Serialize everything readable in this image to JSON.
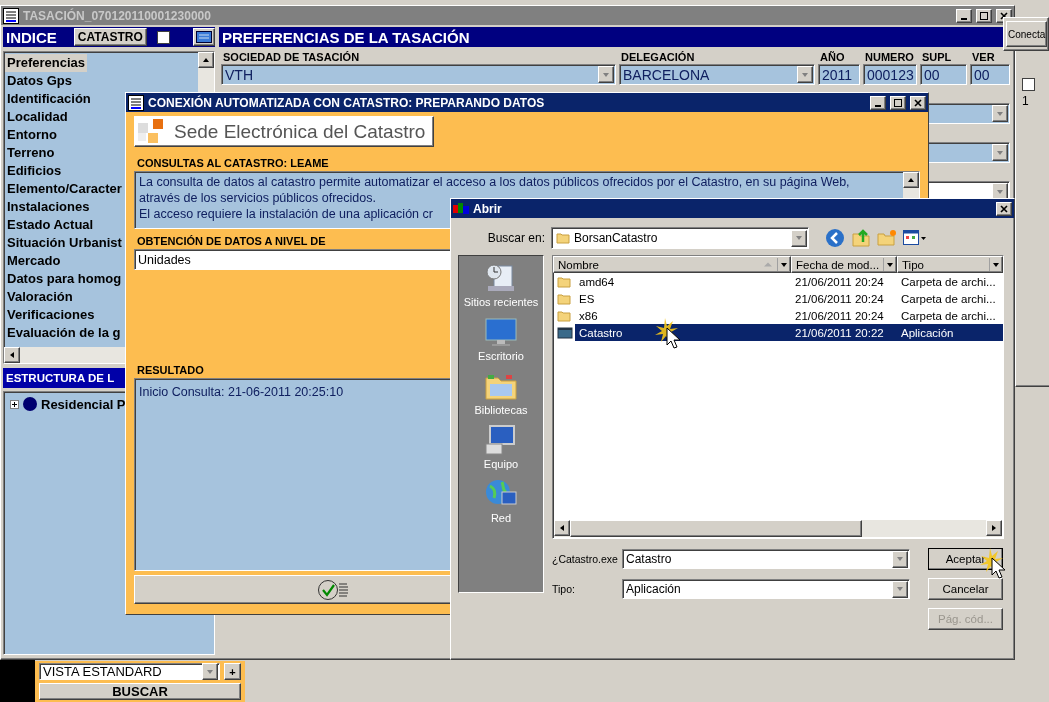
{
  "main_window": {
    "title": "TASACIÓN_070120110001230000"
  },
  "index_panel": {
    "title": "INDICE",
    "catastro_button": "CATASTRO",
    "checked": false,
    "items": [
      {
        "label": "Preferencias",
        "selected": true
      },
      {
        "label": "Datos Gps",
        "selected": false
      },
      {
        "label": "Identificación",
        "selected": false
      },
      {
        "label": "Localidad",
        "selected": false
      },
      {
        "label": "Entorno",
        "selected": false
      },
      {
        "label": "Terreno",
        "selected": false
      },
      {
        "label": "Edificios",
        "selected": false
      },
      {
        "label": "Elemento/Caracter",
        "selected": false
      },
      {
        "label": "Instalaciones",
        "selected": false
      },
      {
        "label": "Estado Actual",
        "selected": false
      },
      {
        "label": "Situación Urbanist",
        "selected": false
      },
      {
        "label": "Mercado",
        "selected": false
      },
      {
        "label": "Datos para homog",
        "selected": false
      },
      {
        "label": "Valoración",
        "selected": false
      },
      {
        "label": "Verificaciones",
        "selected": false
      },
      {
        "label": "Evaluación de la g",
        "selected": false
      }
    ]
  },
  "structure_panel": {
    "title": "ESTRUCTURA DE L",
    "tree": [
      {
        "label": "Residencial P",
        "expanded": false
      }
    ]
  },
  "search_panel": {
    "view": "VISTA ESTANDARD",
    "add_button": "+",
    "search_button": "BUSCAR"
  },
  "preferences": {
    "title": "PREFERENCIAS DE LA TASACIÓN",
    "fields": [
      {
        "label": "SOCIEDAD DE TASACIÓN",
        "value": "VTH",
        "kind": "select"
      },
      {
        "label": "DELEGACIÓN",
        "value": "BARCELONA",
        "kind": "select"
      },
      {
        "label": "AÑO",
        "value": "2011",
        "kind": "text"
      },
      {
        "label": "NUMERO",
        "value": "000123",
        "kind": "text"
      },
      {
        "label": "SUPL",
        "value": "00",
        "kind": "text"
      },
      {
        "label": "VER",
        "value": "00",
        "kind": "text"
      }
    ]
  },
  "side_window": {
    "button": "Conecta",
    "checked": false,
    "cell": "1"
  },
  "catastro_dialog": {
    "title": "CONEXIÓN AUTOMATIZADA CON CATASTRO: PREPARANDO DATOS",
    "logo_text": "Sede Electrónica del Catastro",
    "readme_label": "CONSULTAS AL CATASTRO: LEAME",
    "readme_lines": [
      "La consulta de datos al catastro permite automatizar el acceso a los datos públicos ofrecidos por el Catastro, en su página Web,",
      "através de los servicios públicos ofrecidos.",
      "El acceso requiere la instalación de una aplicación cr"
    ],
    "level_label": "OBTENCIÓN DE DATOS A NIVEL DE",
    "level_value": "Unidades",
    "result_label": "RESULTADO",
    "result_text": "Inicio Consulta: 21-06-2011 20:25:10"
  },
  "open_dialog": {
    "title": "Abrir",
    "look_in_label": "Buscar en:",
    "look_in_value": "BorsanCatastro",
    "places": [
      {
        "label": "Sitios recientes",
        "kind": "recent"
      },
      {
        "label": "Escritorio",
        "kind": "desktop"
      },
      {
        "label": "Bibliotecas",
        "kind": "libraries"
      },
      {
        "label": "Equipo",
        "kind": "computer"
      },
      {
        "label": "Red",
        "kind": "network"
      }
    ],
    "columns": [
      "Nombre",
      "Fecha de mod...",
      "Tipo"
    ],
    "files": [
      {
        "name": "amd64",
        "date": "21/06/2011 20:24",
        "type": "Carpeta de archi...",
        "kind": "folder",
        "selected": false
      },
      {
        "name": "ES",
        "date": "21/06/2011 20:24",
        "type": "Carpeta de archi...",
        "kind": "folder",
        "selected": false
      },
      {
        "name": "x86",
        "date": "21/06/2011 20:24",
        "type": "Carpeta de archi...",
        "kind": "folder",
        "selected": false
      },
      {
        "name": "Catastro",
        "date": "21/06/2011 20:22",
        "type": "Aplicación",
        "kind": "app",
        "selected": true
      }
    ],
    "filename_label": "¿Catastro.exe",
    "filename_value": "Catastro",
    "type_label": "Tipo:",
    "type_value": "Aplicación",
    "buttons": [
      {
        "label": "Aceptar",
        "disabled": false
      },
      {
        "label": "Cancelar",
        "disabled": false
      },
      {
        "label": "Pág. cód...",
        "disabled": true
      }
    ]
  }
}
